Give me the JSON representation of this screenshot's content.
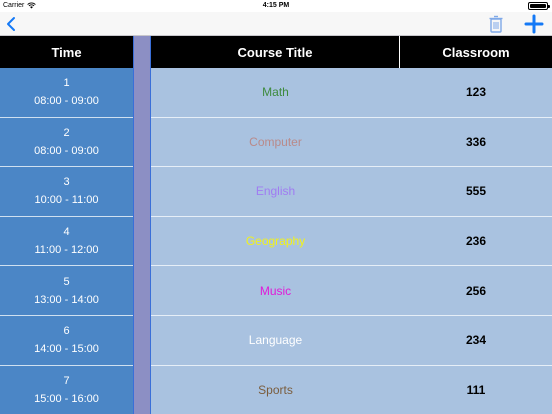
{
  "status_bar": {
    "carrier": "Carrier",
    "time": "4:15 PM"
  },
  "nav_bar": {
    "back_icon": "chevron-left-icon",
    "trash_icon": "trash-icon",
    "add_icon": "plus-icon",
    "accent_color": "#1479f6"
  },
  "table": {
    "headers": {
      "time": "Time",
      "course": "Course Title",
      "room": "Classroom"
    },
    "rows": [
      {
        "period": "1",
        "time": "08:00 - 09:00",
        "course": "Math",
        "course_color": "#3d8a3d",
        "room": "123"
      },
      {
        "period": "2",
        "time": "08:00 - 09:00",
        "course": "Computer",
        "course_color": "#b98a8a",
        "room": "336"
      },
      {
        "period": "3",
        "time": "10:00 - 11:00",
        "course": "English",
        "course_color": "#a07cf2",
        "room": "555"
      },
      {
        "period": "4",
        "time": "11:00 - 12:00",
        "course": "Geography",
        "course_color": "#f2f21a",
        "room": "236"
      },
      {
        "period": "5",
        "time": "13:00 - 14:00",
        "course": "Music",
        "course_color": "#e01ad8",
        "room": "256"
      },
      {
        "period": "6",
        "time": "14:00 - 15:00",
        "course": "Language",
        "course_color": "#ffffff",
        "room": "234"
      },
      {
        "period": "7",
        "time": "15:00 - 16:00",
        "course": "Sports",
        "course_color": "#7a5c3c",
        "room": "111"
      }
    ]
  }
}
